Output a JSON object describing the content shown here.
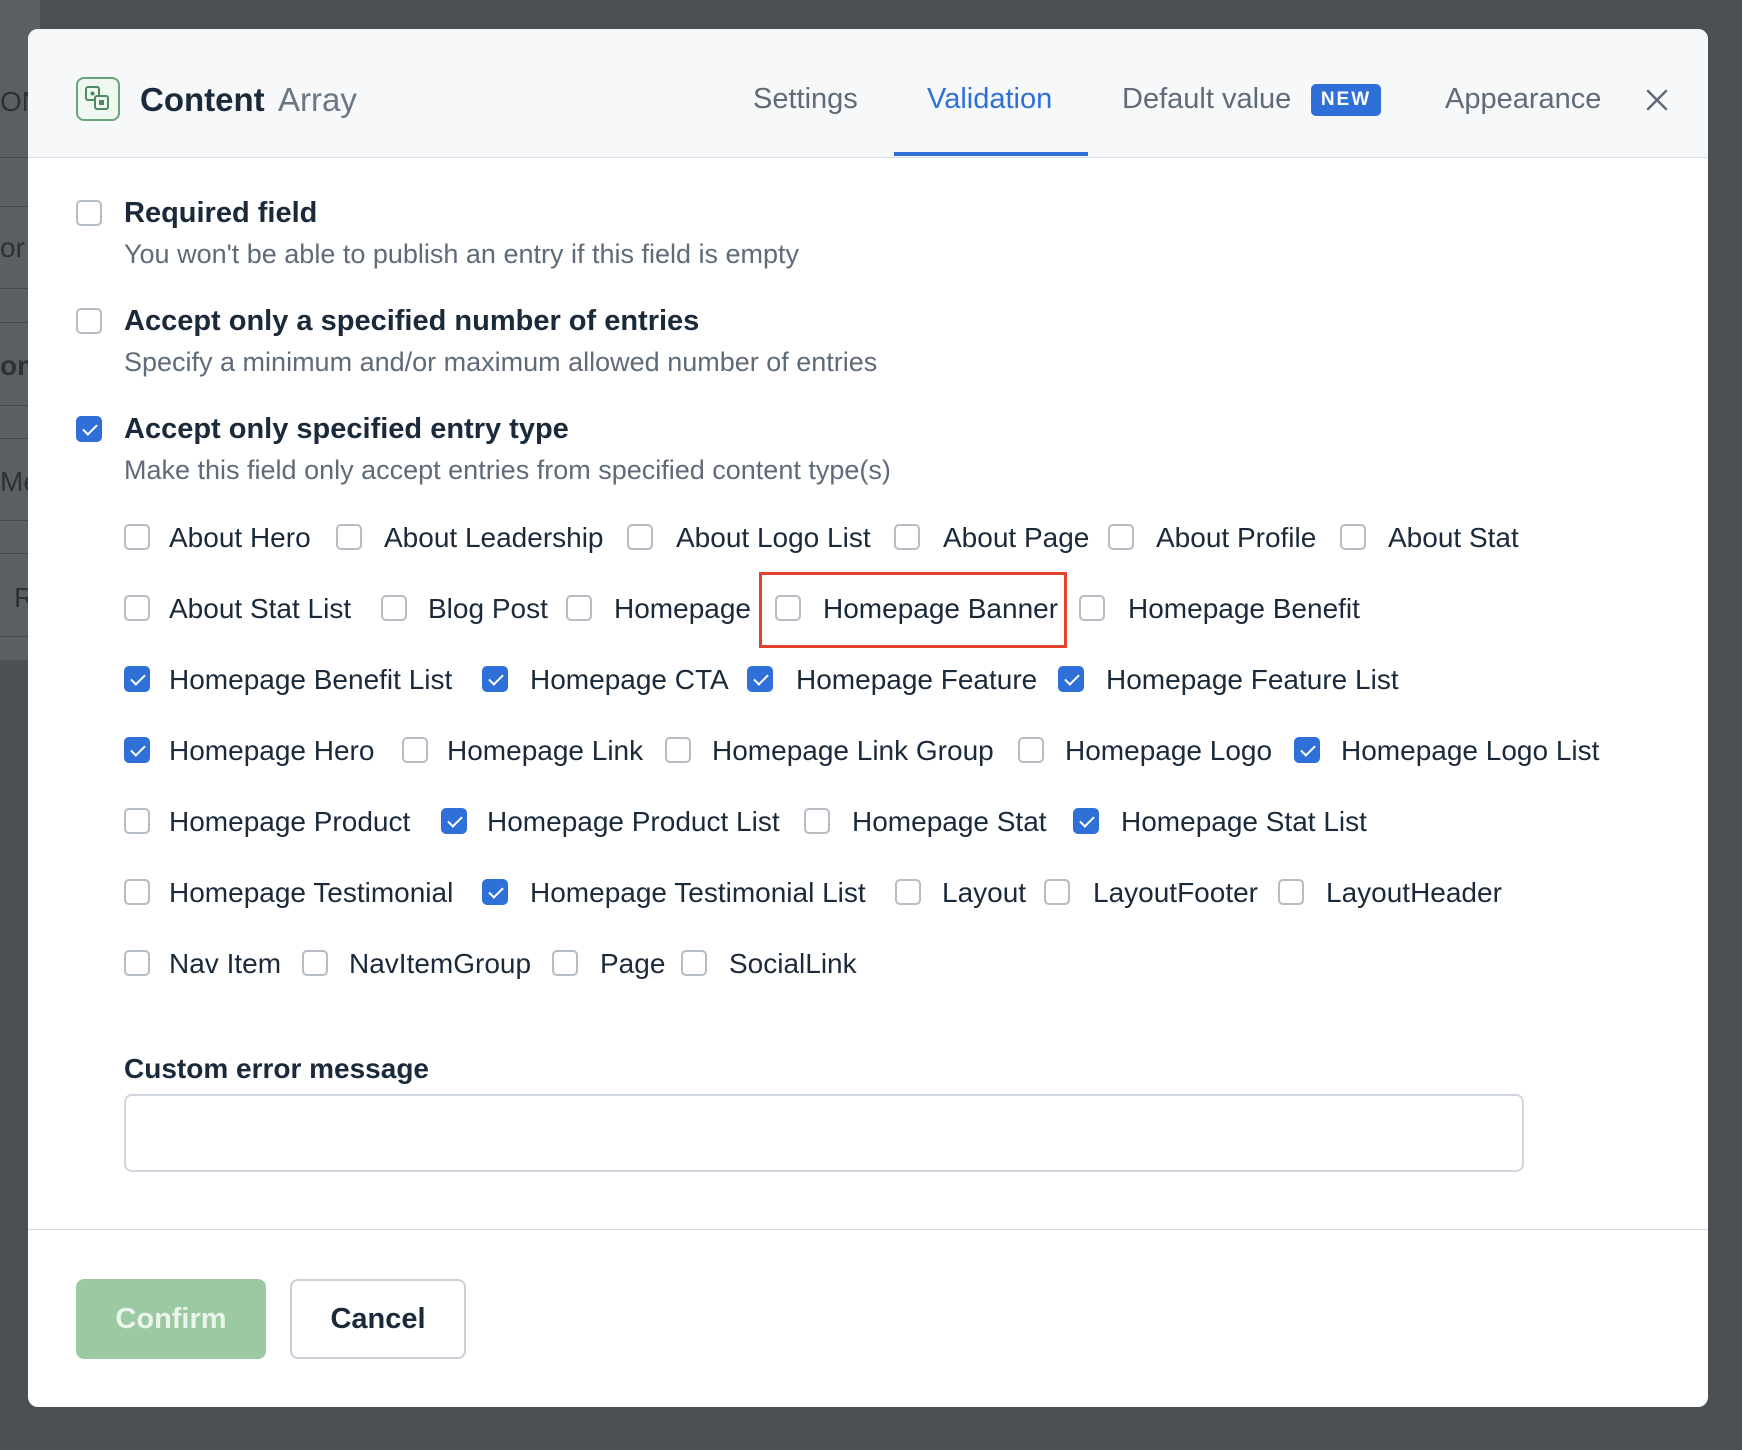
{
  "background": {
    "fragments": [
      "ON",
      "or",
      "on",
      "Me",
      "R"
    ]
  },
  "header": {
    "icon": "content-array-icon",
    "title": "Content",
    "subtitle": "Array",
    "tabs": [
      "Settings",
      "Validation",
      "Default value",
      "Appearance"
    ],
    "active_tab": "Validation",
    "new_badge": "NEW",
    "close_icon": "close-icon"
  },
  "validation": {
    "required": {
      "label": "Required field",
      "description": "You won't be able to publish an entry if this field is empty",
      "checked": false
    },
    "entry_count": {
      "label": "Accept only a specified number of entries",
      "description": "Specify a minimum and/or maximum allowed number of entries",
      "checked": false
    },
    "entry_type": {
      "label": "Accept only specified entry type",
      "description": "Make this field only accept entries from specified content type(s)",
      "checked": true
    },
    "content_types": [
      {
        "label": "About Hero",
        "checked": false
      },
      {
        "label": "About Leadership",
        "checked": false
      },
      {
        "label": "About Logo List",
        "checked": false
      },
      {
        "label": "About Page",
        "checked": false
      },
      {
        "label": "About Profile",
        "checked": false
      },
      {
        "label": "About Stat",
        "checked": false
      },
      {
        "label": "About Stat List",
        "checked": false
      },
      {
        "label": "Blog Post",
        "checked": false
      },
      {
        "label": "Homepage",
        "checked": false
      },
      {
        "label": "Homepage Banner",
        "checked": false
      },
      {
        "label": "Homepage Benefit",
        "checked": false
      },
      {
        "label": "Homepage Benefit List",
        "checked": true
      },
      {
        "label": "Homepage CTA",
        "checked": true
      },
      {
        "label": "Homepage Feature",
        "checked": true
      },
      {
        "label": "Homepage Feature List",
        "checked": true
      },
      {
        "label": "Homepage Hero",
        "checked": true
      },
      {
        "label": "Homepage Link",
        "checked": false
      },
      {
        "label": "Homepage Link Group",
        "checked": false
      },
      {
        "label": "Homepage Logo",
        "checked": false
      },
      {
        "label": "Homepage Logo List",
        "checked": true
      },
      {
        "label": "Homepage Product",
        "checked": false
      },
      {
        "label": "Homepage Product List",
        "checked": true
      },
      {
        "label": "Homepage Stat",
        "checked": false
      },
      {
        "label": "Homepage Stat List",
        "checked": true
      },
      {
        "label": "Homepage Testimonial",
        "checked": false
      },
      {
        "label": "Homepage Testimonial List",
        "checked": true
      },
      {
        "label": "Layout",
        "checked": false
      },
      {
        "label": "LayoutFooter",
        "checked": false
      },
      {
        "label": "LayoutHeader",
        "checked": false
      },
      {
        "label": "Nav Item",
        "checked": false
      },
      {
        "label": "NavItemGroup",
        "checked": false
      },
      {
        "label": "Page",
        "checked": false
      },
      {
        "label": "SocialLink",
        "checked": false
      }
    ],
    "highlighted_type": "Homepage Banner",
    "highlight_color": "#e2412e",
    "custom_error": {
      "label": "Custom error message",
      "value": "",
      "placeholder": ""
    }
  },
  "footer": {
    "confirm_label": "Confirm",
    "cancel_label": "Cancel"
  },
  "colors": {
    "accent": "#2e6fd8",
    "confirm_disabled": "#9bc9a2"
  }
}
